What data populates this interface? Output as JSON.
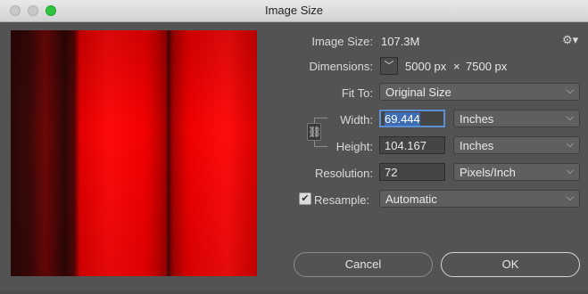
{
  "window": {
    "title": "Image Size"
  },
  "image_size": {
    "label": "Image Size:",
    "value": "107.3M"
  },
  "dimensions": {
    "label": "Dimensions:",
    "width": "5000 px",
    "times": "×",
    "height": "7500 px"
  },
  "fit_to": {
    "label": "Fit To:",
    "value": "Original Size"
  },
  "width": {
    "label": "Width:",
    "value": "69.444",
    "unit": "Inches"
  },
  "height": {
    "label": "Height:",
    "value": "104.167",
    "unit": "Inches"
  },
  "resolution": {
    "label": "Resolution:",
    "value": "72",
    "unit": "Pixels/Inch"
  },
  "resample": {
    "label": "Resample:",
    "checked": true,
    "value": "Automatic"
  },
  "buttons": {
    "cancel": "Cancel",
    "ok": "OK"
  },
  "icons": {
    "gear": "gear-icon",
    "link": "chain-link-icon",
    "chevron": "chevron-down-icon"
  }
}
